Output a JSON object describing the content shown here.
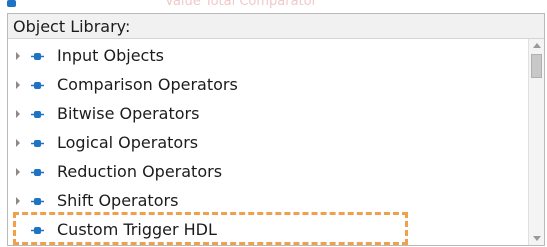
{
  "header": {
    "faded_text": "Value   Total Comparator",
    "icon": "blue-node-icon"
  },
  "panel": {
    "title": "Object Library:"
  },
  "items": [
    {
      "label": "Input Objects",
      "expandable": true,
      "icon": "blue-node-icon"
    },
    {
      "label": "Comparison Operators",
      "expandable": true,
      "icon": "blue-node-icon"
    },
    {
      "label": "Bitwise Operators",
      "expandable": true,
      "icon": "blue-node-icon"
    },
    {
      "label": "Logical Operators",
      "expandable": true,
      "icon": "blue-node-icon"
    },
    {
      "label": "Reduction Operators",
      "expandable": true,
      "icon": "blue-node-icon"
    },
    {
      "label": "Shift Operators",
      "expandable": true,
      "icon": "blue-node-icon"
    },
    {
      "label": "Custom Trigger HDL",
      "expandable": false,
      "icon": "blue-node-icon",
      "highlighted": true
    }
  ],
  "colors": {
    "node_icon": "#1f73c4",
    "highlight_border": "#f0a04a",
    "panel_border": "#b9b9b9"
  }
}
